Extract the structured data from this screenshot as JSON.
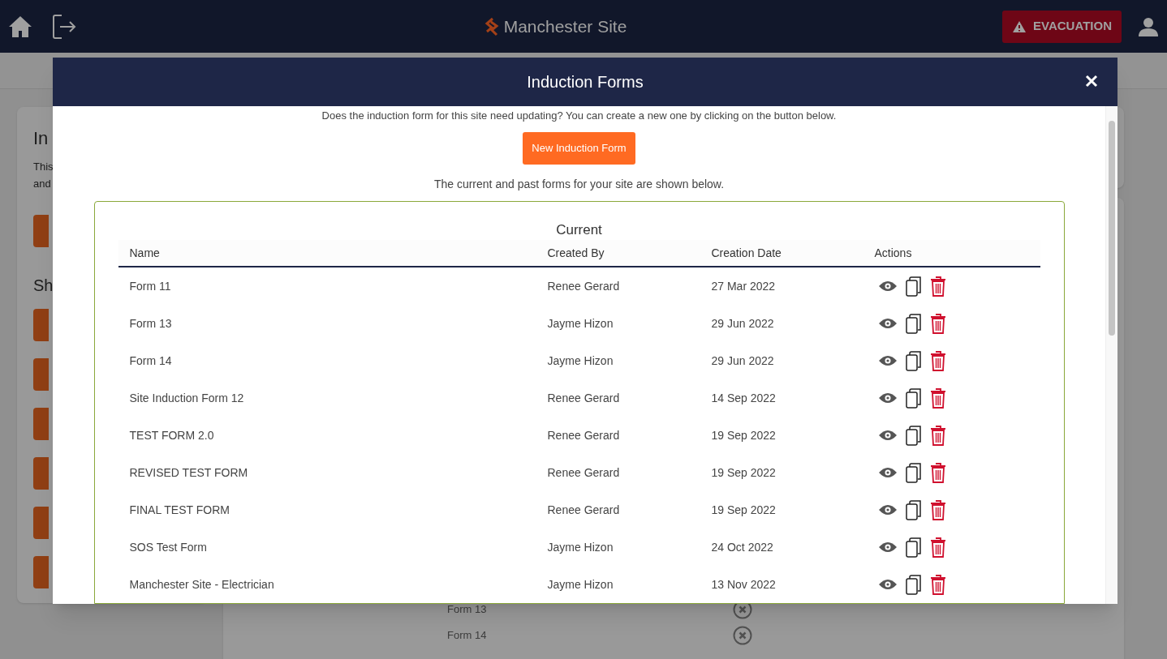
{
  "nav": {
    "title": "Manchester Site",
    "evacuation_button": "EVACUATION"
  },
  "background": {
    "card_title": "In",
    "card_text": [
      "This",
      "and"
    ],
    "section_title": "Sh",
    "list_rows": [
      "Form 13",
      "Form 14"
    ]
  },
  "modal": {
    "title": "Induction Forms",
    "intro": "Does the induction form for this site need updating? You can create a new one by clicking on the button below.",
    "new_button": "New Induction Form",
    "note": "The current and past forms for your site are shown below.",
    "table": {
      "caption": "Current",
      "columns": [
        "Name",
        "Created By",
        "Creation Date",
        "Actions"
      ],
      "rows": [
        {
          "name": "Form 11",
          "created_by": "Renee Gerard",
          "creation_date": "27 Mar 2022"
        },
        {
          "name": "Form 13",
          "created_by": "Jayme Hizon",
          "creation_date": "29 Jun 2022"
        },
        {
          "name": "Form 14",
          "created_by": "Jayme Hizon",
          "creation_date": "29 Jun 2022"
        },
        {
          "name": "Site Induction Form 12",
          "created_by": "Renee Gerard",
          "creation_date": "14 Sep 2022"
        },
        {
          "name": "TEST FORM 2.0",
          "created_by": "Renee Gerard",
          "creation_date": "19 Sep 2022"
        },
        {
          "name": "REVISED TEST FORM",
          "created_by": "Renee Gerard",
          "creation_date": "19 Sep 2022"
        },
        {
          "name": "FINAL TEST FORM",
          "created_by": "Renee Gerard",
          "creation_date": "19 Sep 2022"
        },
        {
          "name": "SOS Test Form",
          "created_by": "Jayme Hizon",
          "creation_date": "24 Oct 2022"
        },
        {
          "name": "Manchester Site - Electrician",
          "created_by": "Jayme Hizon",
          "creation_date": "13 Nov 2022"
        }
      ]
    }
  }
}
